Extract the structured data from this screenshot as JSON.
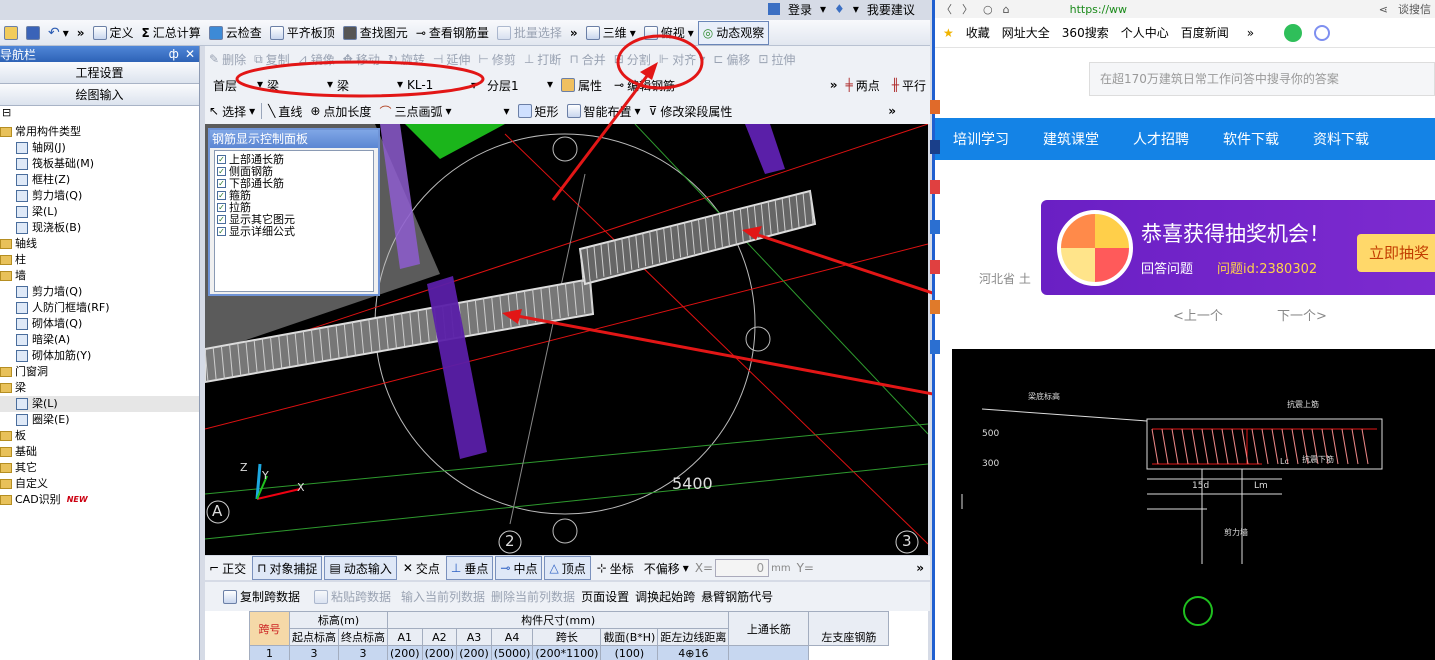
{
  "top_right": {
    "login": "登录",
    "suggest": "我要建议"
  },
  "toolbar1": {
    "define": "定义",
    "summary": "汇总计算",
    "cloud_check": "云检查",
    "align_top": "平齐板顶",
    "find": "查找图元",
    "view_rebar": "查看钢筋量",
    "batch_select": "批量选择",
    "three_d": "三维",
    "top_view": "俯视",
    "dynamic": "动态观察"
  },
  "toolbar2": {
    "delete": "删除",
    "copy": "复制",
    "mirror": "镜像",
    "move": "移动",
    "rotate": "旋转",
    "extend": "延伸",
    "trim": "修剪",
    "break": "打断",
    "merge": "合并",
    "split": "分割",
    "align": "对齐",
    "offset": "偏移",
    "stretch": "拉伸"
  },
  "toolbar3": {
    "floor": "首层",
    "type": "梁",
    "subtype": "梁",
    "component": "KL-1",
    "layer": "分层1",
    "property": "属性",
    "edit_rebar": "编辑钢筋",
    "two_point": "两点",
    "parallel": "平行"
  },
  "toolbar4": {
    "select": "选择",
    "line": "直线",
    "point_length": "点加长度",
    "arc": "三点画弧",
    "rect": "矩形",
    "smart": "智能布置",
    "modify_span": "修改梁段属性"
  },
  "nav": {
    "title": "导航栏",
    "pin": "ф",
    "tabs": [
      "工程设置",
      "绘图输入"
    ],
    "tree": [
      {
        "label": "常用构件类型",
        "level": 0,
        "kind": "folder"
      },
      {
        "label": "轴网(J)",
        "level": 1,
        "kind": "item"
      },
      {
        "label": "筏板基础(M)",
        "level": 1,
        "kind": "item"
      },
      {
        "label": "框柱(Z)",
        "level": 1,
        "kind": "item"
      },
      {
        "label": "剪力墙(Q)",
        "level": 1,
        "kind": "item"
      },
      {
        "label": "梁(L)",
        "level": 1,
        "kind": "item"
      },
      {
        "label": "现浇板(B)",
        "level": 1,
        "kind": "item"
      },
      {
        "label": "轴线",
        "level": 0,
        "kind": "folder"
      },
      {
        "label": "柱",
        "level": 0,
        "kind": "folder"
      },
      {
        "label": "墙",
        "level": 0,
        "kind": "folder"
      },
      {
        "label": "剪力墙(Q)",
        "level": 1,
        "kind": "item"
      },
      {
        "label": "人防门框墙(RF)",
        "level": 1,
        "kind": "item"
      },
      {
        "label": "砌体墙(Q)",
        "level": 1,
        "kind": "item"
      },
      {
        "label": "暗梁(A)",
        "level": 1,
        "kind": "item"
      },
      {
        "label": "砌体加筋(Y)",
        "level": 1,
        "kind": "item"
      },
      {
        "label": "门窗洞",
        "level": 0,
        "kind": "folder"
      },
      {
        "label": "梁",
        "level": 0,
        "kind": "folder"
      },
      {
        "label": "梁(L)",
        "level": 1,
        "kind": "item"
      },
      {
        "label": "圈梁(E)",
        "level": 1,
        "kind": "item"
      },
      {
        "label": "板",
        "level": 0,
        "kind": "folder"
      },
      {
        "label": "基础",
        "level": 0,
        "kind": "folder"
      },
      {
        "label": "其它",
        "level": 0,
        "kind": "folder"
      },
      {
        "label": "自定义",
        "level": 0,
        "kind": "folder"
      },
      {
        "label": "CAD识别",
        "level": 0,
        "kind": "folder",
        "badge": "NEW"
      }
    ]
  },
  "rebar_panel": {
    "title": "钢筋显示控制面板",
    "items": [
      "上部通长筋",
      "侧面钢筋",
      "下部通长筋",
      "箍筋",
      "拉筋",
      "显示其它图元",
      "显示详细公式"
    ]
  },
  "viewport": {
    "dimension": "5400",
    "axis_a": "A",
    "axis_2": "2",
    "axis_3": "3",
    "z": "Z",
    "y": "Y",
    "x": "X"
  },
  "snapbar": {
    "ortho": "正交",
    "snap": "对象捕捉",
    "dyn_input": "动态输入",
    "intersect": "交点",
    "perp": "垂点",
    "mid": "中点",
    "vertex": "顶点",
    "coord": "坐标",
    "offset_mode": "不偏移",
    "x_label": "X=",
    "x_value": "0",
    "unit": "mm",
    "y_label": "Y="
  },
  "tablebar": {
    "copy_span": "复制跨数据",
    "paste_span": "粘贴跨数据",
    "input_col": "输入当前列数据",
    "delete_col": "删除当前列数据",
    "page_setup": "页面设置",
    "swap_start": "调换起始跨",
    "cantilever": "悬臂钢筋代号"
  },
  "table": {
    "h_span": "跨号",
    "h_elev": "标高(m)",
    "h_dims": "构件尺寸(mm)",
    "h_top": "上通长筋",
    "h_left": "左支座钢筋",
    "sub": [
      "起点标高",
      "终点标高",
      "A1",
      "A2",
      "A3",
      "A4",
      "跨长",
      "截面(B*H)",
      "距左边线距离"
    ],
    "row": [
      "1",
      "3",
      "3",
      "(200)",
      "(200)",
      "(200)",
      "",
      "(5000)",
      "(200*1100)",
      "(100)",
      "4⊕16",
      ""
    ]
  },
  "browser": {
    "url": "https://ww",
    "search_right": "谈搜信",
    "bookmarks": [
      "收藏",
      "网址大全",
      "360搜索",
      "个人中心",
      "百度新闻"
    ],
    "search_placeholder": "在超170万建筑日常工作问答中搜寻你的答案",
    "nav": [
      "培训学习",
      "建筑课堂",
      "人才招聘",
      "软件下载",
      "资料下载"
    ],
    "banner_title": "恭喜获得抽奖机会！",
    "banner_sub": "回答问题",
    "banner_id": "问题id:2380302",
    "banner_btn": "立即抽奖",
    "location": "河北省  土",
    "prev": "<上一个",
    "next": "下一个>",
    "cad_labels": [
      "梁底标高",
      "抗震上筋",
      "抗震下筋",
      "500",
      "300",
      "15d",
      "Lm",
      "Lc",
      "剪力墙"
    ]
  }
}
